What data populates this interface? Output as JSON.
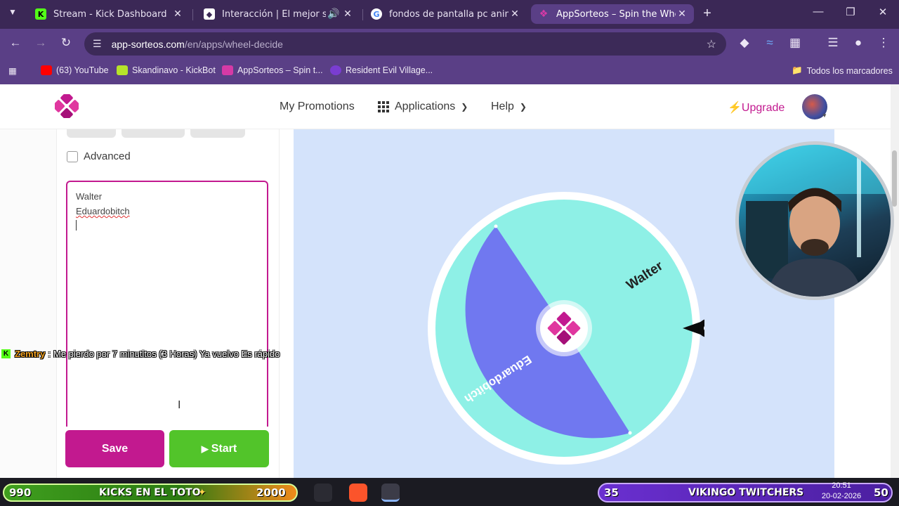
{
  "browser": {
    "tabs": [
      {
        "title": "Stream - Kick Dashboard",
        "favicon": "kick-icon",
        "active": false
      },
      {
        "title": "Interacción | El mejor softw",
        "favicon": "streamerbot-icon",
        "active": false
      },
      {
        "title": "fondos de pantalla pc anime 4k",
        "favicon": "google-icon",
        "active": false
      },
      {
        "title": "AppSorteos – Spin the Wheel (",
        "favicon": "appsorteos-icon",
        "active": true
      }
    ],
    "url_host": "app-sorteos.com",
    "url_path": "/en/apps/wheel-decide",
    "bookmarks": [
      {
        "label": "(63) YouTube",
        "icon": "youtube-icon"
      },
      {
        "label": "Skandinavo - KickBot",
        "icon": "kickbot-icon"
      },
      {
        "label": "AppSorteos – Spin t...",
        "icon": "appsorteos-icon"
      },
      {
        "label": "Resident Evil Village...",
        "icon": "re-icon"
      }
    ],
    "all_bookmarks": "Todos los marcadores"
  },
  "nav": {
    "my_promotions": "My Promotions",
    "applications": "Applications",
    "help": "Help",
    "upgrade": "Upgrade"
  },
  "panel": {
    "advanced_label": "Advanced",
    "entries": [
      "Walter",
      "Eduardobitch"
    ],
    "save_label": "Save",
    "start_label": "Start"
  },
  "wheel": {
    "segments": [
      {
        "label": "Walter",
        "color": "#8ef0e6"
      },
      {
        "label": "Eduardobitch",
        "color": "#7078f0"
      }
    ]
  },
  "chat": {
    "username": "Zemtry",
    "separator": ":",
    "message": "Me pierdo por 7 minutitos (3 Horas) Ya vuelvo Es rápido"
  },
  "overlay": {
    "left_count": "990",
    "left_title": "KICKS EN EL TOTO",
    "left_value": "2000",
    "right_count": "35",
    "right_title": "VIKINGO TWITCHERS",
    "right_value": "50"
  },
  "clock": {
    "time": "20:51",
    "date": "20-02-2026"
  },
  "colors": {
    "brand": "#c2198f",
    "start": "#52c42a",
    "stage": "#d4e3fb"
  }
}
